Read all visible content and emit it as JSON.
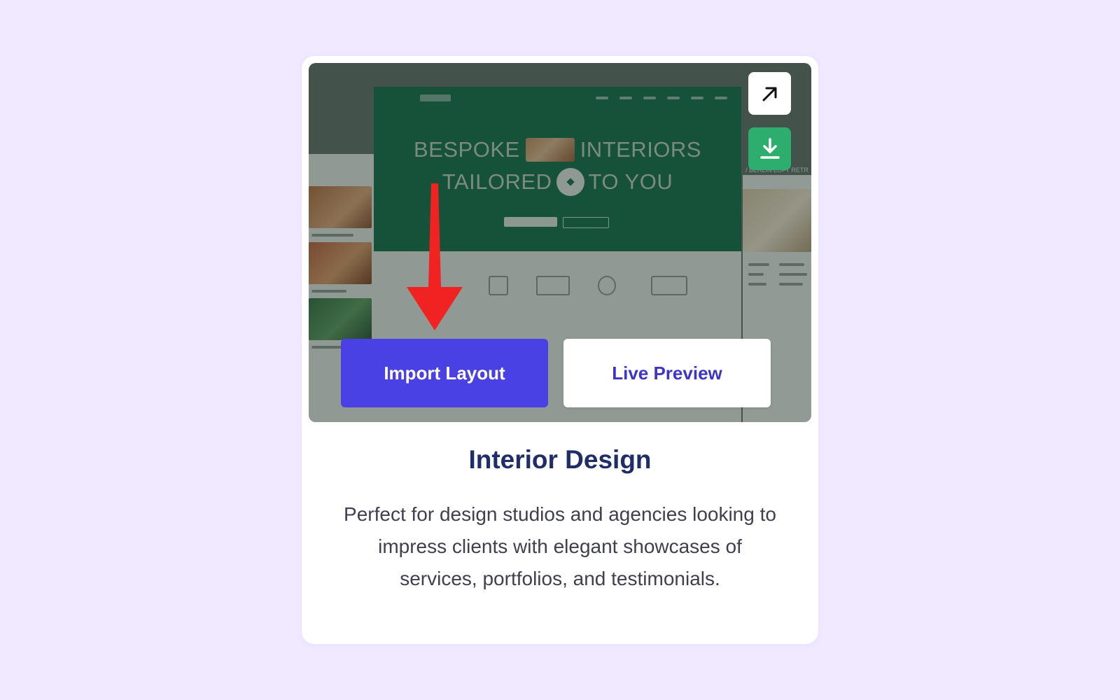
{
  "card": {
    "preview": {
      "hero_line1_left": "BESPOKE",
      "hero_line1_right": "INTERIORS",
      "hero_line2_left": "TAILORED",
      "hero_line2_right": "TO YOU",
      "side_right_label": "/ BERLIN LOFT RETR"
    },
    "actions": {
      "import_label": "Import Layout",
      "preview_label": "Live Preview"
    },
    "corner_icons": {
      "expand": "arrow-up-right-icon",
      "download": "download-icon"
    },
    "title": "Interior Design",
    "description": "Perfect for design studios and agencies looking to impress clients with elegant showcases of services, portfolios, and testimonials."
  },
  "colors": {
    "page_background": "#f1e9ff",
    "primary_button": "#4a41e5",
    "secondary_button_text": "#3d35c9",
    "download_button": "#2eae6e",
    "title": "#1f2d6b",
    "hero_green": "#0f6b47",
    "annotation_arrow": "#f02222"
  }
}
